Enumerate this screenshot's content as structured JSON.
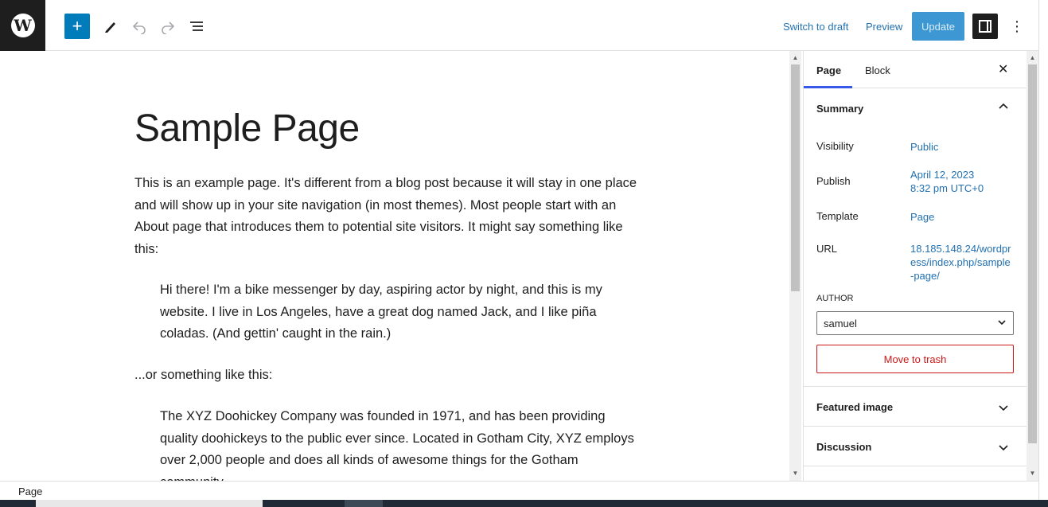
{
  "toolbar": {
    "logo_letter": "W",
    "add_symbol": "+",
    "switch_to_draft": "Switch to draft",
    "preview": "Preview",
    "update": "Update"
  },
  "editor": {
    "title": "Sample Page",
    "paragraph1": "This is an example page. It's different from a blog post because it will stay in one place and will show up in your site navigation (in most themes). Most people start with an About page that introduces them to potential site visitors. It might say something like this:",
    "quote1": "Hi there! I'm a bike messenger by day, aspiring actor by night, and this is my website. I live in Los Angeles, have a great dog named Jack, and I like piña coladas. (And gettin' caught in the rain.)",
    "paragraph2": "...or something like this:",
    "quote2": "The XYZ Doohickey Company was founded in 1971, and has been providing quality doohickeys to the public ever since. Located in Gotham City, XYZ employs over 2,000 people and does all kinds of awesome things for the Gotham community."
  },
  "sidebar": {
    "tabs": [
      "Page",
      "Block"
    ],
    "summary": {
      "heading": "Summary",
      "visibility_label": "Visibility",
      "visibility_value": "Public",
      "publish_label": "Publish",
      "publish_date": "April 12, 2023",
      "publish_time": "8:32 pm UTC+0",
      "template_label": "Template",
      "template_value": "Page",
      "url_label": "URL",
      "url_value": "18.185.148.24/wordpress/index.php/sample-page/",
      "author_label": "AUTHOR",
      "author_value": "samuel",
      "trash_label": "Move to trash"
    },
    "featured_image": "Featured image",
    "discussion": "Discussion"
  },
  "footer": {
    "breadcrumb": "Page"
  },
  "colors": {
    "accent": "#007cba",
    "link": "#2271b1",
    "danger": "#cc1818",
    "tab_indicator": "#3858e9"
  },
  "icons": [
    "wordpress-logo-icon",
    "plus-icon",
    "pencil-icon",
    "undo-icon",
    "redo-icon",
    "list-view-icon",
    "sidebar-toggle-icon",
    "more-options-icon",
    "close-icon",
    "chevron-up-icon",
    "chevron-down-icon"
  ]
}
